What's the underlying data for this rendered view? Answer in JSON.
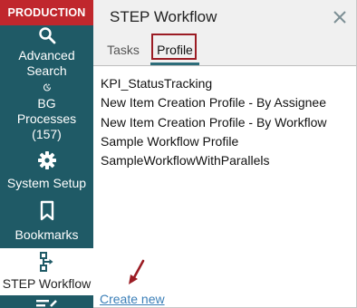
{
  "environment_badge": "PRODUCTION",
  "nav": {
    "items": [
      {
        "label": "Advanced Search",
        "icon": "search-icon"
      },
      {
        "label": "BG Processes (157)",
        "icon": "bg-processes-icon"
      },
      {
        "label": "System Setup",
        "icon": "gear-icon"
      },
      {
        "label": "Bookmarks",
        "icon": "bookmark-icon"
      },
      {
        "label": "STEP Workflow",
        "icon": "workflow-icon"
      }
    ],
    "active": "STEP Workflow"
  },
  "panel": {
    "title": "STEP Workflow",
    "close_icon": "close-icon",
    "tabs": [
      {
        "label": "Tasks",
        "active": false
      },
      {
        "label": "Profile",
        "active": true
      }
    ],
    "profiles": [
      "KPI_StatusTracking",
      "New Item Creation Profile - By Assignee",
      "New Item Creation Profile - By Workflow",
      "Sample Workflow Profile",
      "SampleWorkflowWithParallels"
    ],
    "create_link": "Create new"
  },
  "colors": {
    "sidebar": "#1f5a66",
    "badge": "#c0272d",
    "highlight": "#9b1c24",
    "link": "#3b7fb8",
    "tab_underline": "#2d6d7a"
  }
}
